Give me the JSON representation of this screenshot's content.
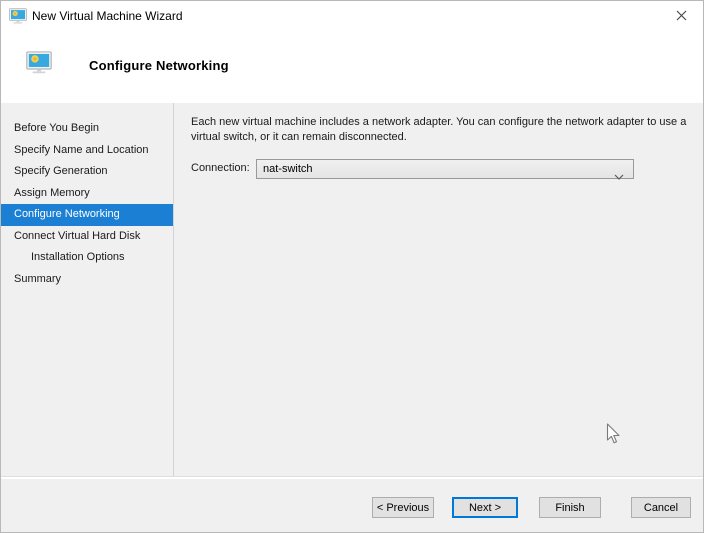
{
  "window": {
    "title": "New Virtual Machine Wizard"
  },
  "header": {
    "title": "Configure Networking"
  },
  "sidebar": {
    "items": [
      {
        "label": "Before You Begin",
        "selected": false,
        "indent": false
      },
      {
        "label": "Specify Name and Location",
        "selected": false,
        "indent": false
      },
      {
        "label": "Specify Generation",
        "selected": false,
        "indent": false
      },
      {
        "label": "Assign Memory",
        "selected": false,
        "indent": false
      },
      {
        "label": "Configure Networking",
        "selected": true,
        "indent": false
      },
      {
        "label": "Connect Virtual Hard Disk",
        "selected": false,
        "indent": false
      },
      {
        "label": "Installation Options",
        "selected": false,
        "indent": true
      },
      {
        "label": "Summary",
        "selected": false,
        "indent": false
      }
    ]
  },
  "main": {
    "description": "Each new virtual machine includes a network adapter. You can configure the network adapter to use a virtual switch, or it can remain disconnected.",
    "connection_label": "Connection:",
    "connection_value": "nat-switch"
  },
  "footer": {
    "previous_label": "< Previous",
    "next_label": "Next >",
    "finish_label": "Finish",
    "cancel_label": "Cancel"
  },
  "icons": {
    "titlebar": "vm-monitor-icon",
    "header": "vm-monitor-icon",
    "close": "close-icon",
    "combobox": "chevron-down-icon",
    "pointer": "arrow-cursor"
  },
  "colors": {
    "selected_step_bg": "#1b7fd3",
    "focused_button_border": "#0078d7",
    "monitor_screen_blue": "#38a9e0",
    "monitor_gear_yellow": "#f2cf4a",
    "content_bg": "#f0f0f0"
  }
}
